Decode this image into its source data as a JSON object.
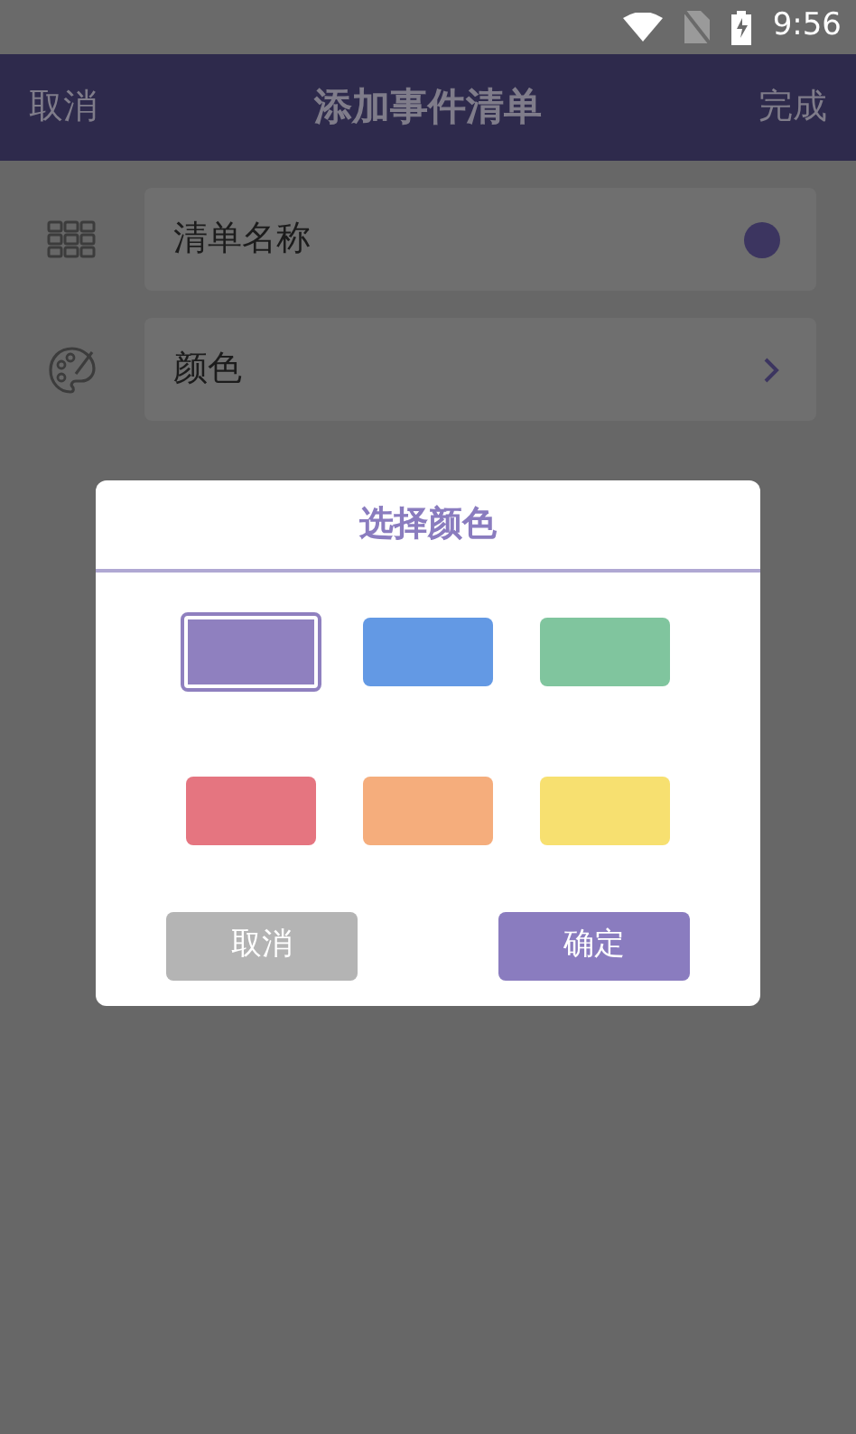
{
  "status_bar": {
    "time": "9:56"
  },
  "header": {
    "cancel": "取消",
    "title": "添加事件清单",
    "done": "完成"
  },
  "rows": [
    {
      "kind": "name",
      "label": "清单名称"
    },
    {
      "kind": "color",
      "label": "颜色"
    }
  ],
  "dialog": {
    "title": "选择颜色",
    "swatches": [
      {
        "color": "#8f80bf",
        "selected": true
      },
      {
        "color": "#6399e4",
        "selected": false
      },
      {
        "color": "#80c59e",
        "selected": false
      },
      {
        "color": "#e57580",
        "selected": false
      },
      {
        "color": "#f5ad7c",
        "selected": false
      },
      {
        "color": "#f7e070",
        "selected": false
      }
    ],
    "cancel": "取消",
    "confirm": "确定"
  }
}
